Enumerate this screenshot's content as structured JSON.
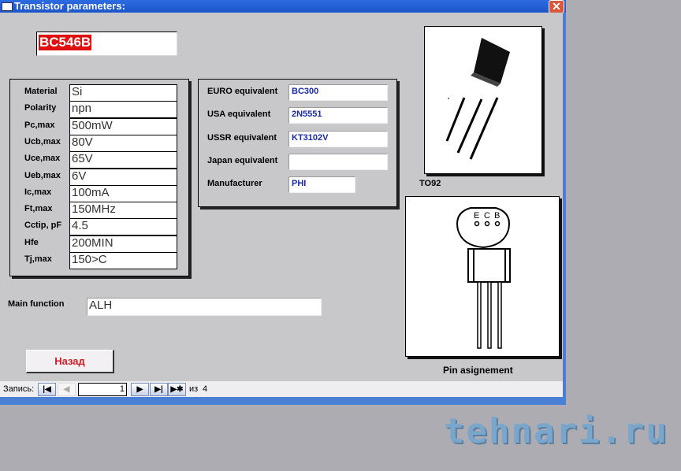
{
  "window": {
    "title": "Transistor parameters:",
    "close": "✕"
  },
  "part_number": "BC546B",
  "params": [
    {
      "label": "Material",
      "value": "Si"
    },
    {
      "label": "Polarity",
      "value": "npn"
    },
    {
      "label": "Pc,max",
      "value": "500mW"
    },
    {
      "label": "Ucb,max",
      "value": "80V"
    },
    {
      "label": "Uce,max",
      "value": "65V"
    },
    {
      "label": "Ueb,max",
      "value": "6V"
    },
    {
      "label": "Ic,max",
      "value": "100mA"
    },
    {
      "label": "Ft,max",
      "value": "150MHz"
    },
    {
      "label": "Cctip, pF",
      "value": "4.5"
    },
    {
      "label": "Hfe",
      "value": "200MIN"
    },
    {
      "label": "Tj,max",
      "value": "150>C"
    }
  ],
  "equivalents": [
    {
      "label": "EURO equivalent",
      "value": "BC300"
    },
    {
      "label": "USA equivalent",
      "value": "2N5551"
    },
    {
      "label": "USSR equivalent",
      "value": "KT3102V"
    },
    {
      "label": "Japan equivalent",
      "value": ""
    },
    {
      "label": "Manufacturer",
      "value": "PHI"
    }
  ],
  "package": {
    "caption": "TO92"
  },
  "pinout": {
    "caption": "Pin asignement",
    "pins": [
      "E",
      "C",
      "B"
    ]
  },
  "main_function": {
    "label": "Main function",
    "value": "ALH"
  },
  "back_button": "Назад",
  "record_nav": {
    "label": "Запись:",
    "current": "1",
    "of_label": "из",
    "total": "4"
  },
  "watermark": "tehnari.ru"
}
